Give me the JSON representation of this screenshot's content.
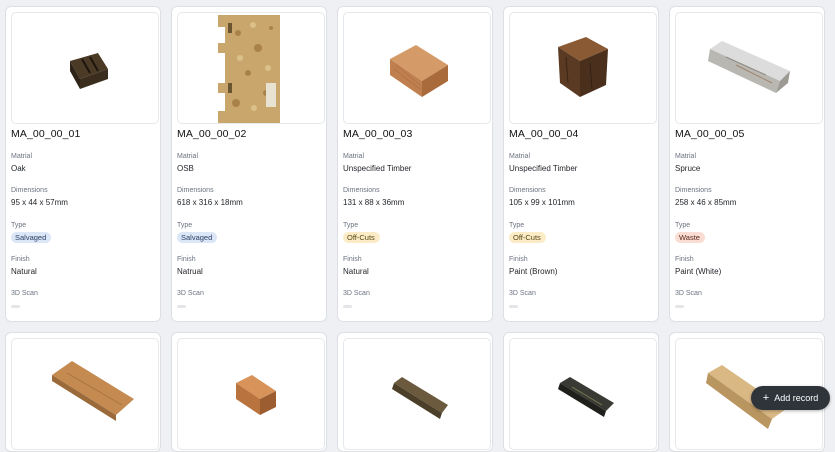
{
  "labels": {
    "material": "Matrial",
    "dimensions": "Dimensions",
    "type": "Type",
    "finish": "Finish",
    "scan": "3D Scan"
  },
  "records": [
    {
      "id": "MA_00_00_01",
      "material": "Oak",
      "dimensions": "95 x 44 x 57mm",
      "type": "Salvaged",
      "finish": "Natural",
      "image": "oak-block-image"
    },
    {
      "id": "MA_00_00_02",
      "material": "OSB",
      "dimensions": "618 x 316 x 18mm",
      "type": "Salvaged",
      "finish": "Natrual",
      "image": "osb-board-image"
    },
    {
      "id": "MA_00_00_03",
      "material": "Unspecified Timber",
      "dimensions": "131 x 88 x 36mm",
      "type": "Off-Cuts",
      "finish": "Natural",
      "image": "timber-block-image"
    },
    {
      "id": "MA_00_00_04",
      "material": "Unspecified Timber",
      "dimensions": "105 x 99 x 101mm",
      "type": "Off-Cuts",
      "finish": "Paint (Brown)",
      "image": "painted-cube-image"
    },
    {
      "id": "MA_00_00_05",
      "material": "Spruce",
      "dimensions": "258 x 46 x 85mm",
      "type": "Waste",
      "finish": "Paint (White)",
      "image": "white-beam-image"
    }
  ],
  "type_colors": {
    "Salvaged": {
      "bg": "#dbe6f7",
      "fg": "#2a3f63"
    },
    "Off-Cuts": {
      "bg": "#fbecc7",
      "fg": "#5a4512"
    },
    "Waste": {
      "bg": "#f9dcd2",
      "fg": "#5b2a1d"
    }
  },
  "action": {
    "add_label": "Add record",
    "icon": "plus-icon"
  }
}
